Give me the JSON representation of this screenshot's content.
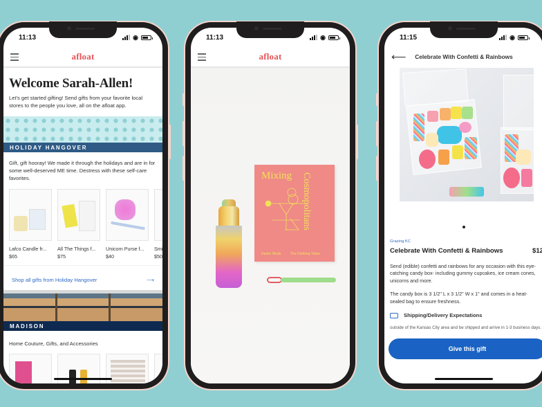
{
  "colors": {
    "background": "#8fcfd2",
    "brand": "#e65358",
    "link": "#2e6ac8",
    "banner_holiday": "#2e5a85",
    "banner_madison": "#0e2a50",
    "primary_button": "#1a63c4"
  },
  "phones": [
    {
      "status": {
        "time": "11:13"
      },
      "appbar": {
        "logo": "afloat",
        "menu_icon": "hamburger-icon"
      },
      "welcome": {
        "title": "Welcome Sarah-Allen!",
        "text": "Let's get started gifting! Send gifts from your favorite local stores to the people you love, all on the afloat app."
      },
      "sections": [
        {
          "banner": "HOLIDAY HANGOVER",
          "description": "Gift, gift hooray! We made it through the holidays and are in for some well-deserved ME time. Destress with these self-care favorites.",
          "products": [
            {
              "name": "Lafco Candle fr...",
              "price": "$65"
            },
            {
              "name": "All The Things f...",
              "price": "$75"
            },
            {
              "name": "Unicorn Purse f...",
              "price": "$40"
            },
            {
              "name": "Smi...",
              "price": "$50"
            }
          ],
          "shop_link": "Shop all gifts from Holiday Hangover"
        },
        {
          "banner": "MADISON",
          "description": "Home Couture, Gifts, and Accessories"
        }
      ]
    },
    {
      "status": {
        "time": "11:13"
      },
      "appbar": {
        "logo": "afloat",
        "menu_icon": "hamburger-icon"
      },
      "book": {
        "title": "Mixing",
        "spine_title": "Cosmopolitans",
        "author": "Daniel Hinds",
        "subtitle": "The Drinking Tinker"
      }
    },
    {
      "status": {
        "time": "11:15"
      },
      "header": {
        "title": "Celebrate With Confetti & Rainbows",
        "back_icon": "arrow-left-icon"
      },
      "product": {
        "store": "Grazing KC",
        "name": "Celebrate With Confetti & Rainbows",
        "price": "$12",
        "description": "Send (edible) confetti and rainbows for any occasion with this eye-catching candy box- including gummy cupcakes, ice cream cones, unicorns and more.",
        "dimensions": "The candy box is 3 1/2\" L x 3 1/2\" W x 1\" and comes in a heat-sealed bag to ensure freshness.",
        "shipping_label": "Shipping/Delivery Expectations",
        "shipping_text": "outside of the Kansas City area and be shipped and arrive in 1-3 business days.",
        "carousel_index": 1
      },
      "cta": "Give this gift"
    }
  ]
}
